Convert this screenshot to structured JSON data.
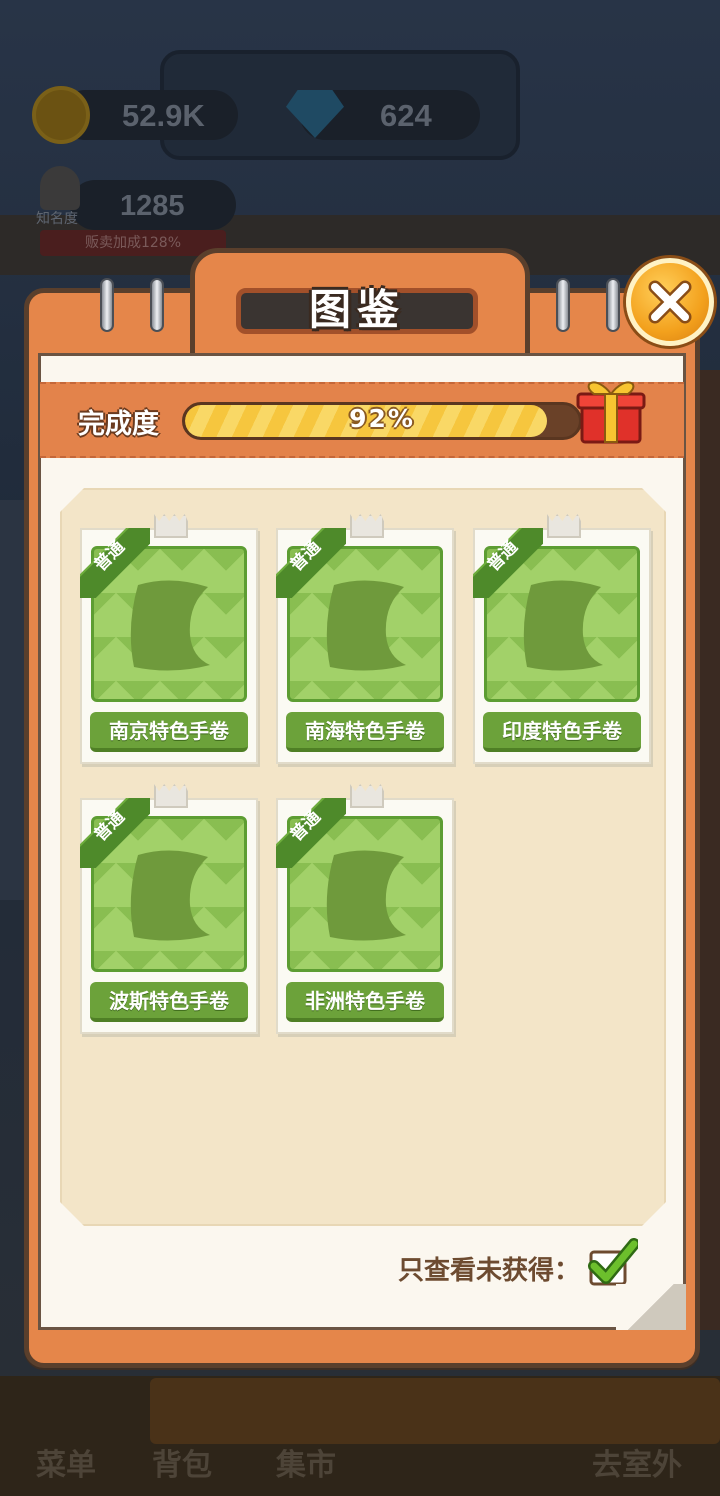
{
  "hud": {
    "coins": "52.9K",
    "gems": "624",
    "fame_value": "1285",
    "fame_label": "知名度",
    "sales_bonus": "贩卖加成128%"
  },
  "bottom_nav": {
    "menu": "菜单",
    "backpack": "背包",
    "market": "集市",
    "go_outside": "去室外"
  },
  "dialog": {
    "title": "图鉴",
    "close_icon": "close-x-icon",
    "progress": {
      "label": "完成度",
      "value_text": "92%",
      "value": 0.92
    },
    "gift_icon": "gift-box-icon",
    "items": [
      {
        "rarity": "普通",
        "name": "南京特色手卷"
      },
      {
        "rarity": "普通",
        "name": "南海特色手卷"
      },
      {
        "rarity": "普通",
        "name": "印度特色手卷"
      },
      {
        "rarity": "普通",
        "name": "波斯特色手卷"
      },
      {
        "rarity": "普通",
        "name": "非洲特色手卷"
      }
    ],
    "filter": {
      "label": "只查看未获得：",
      "checked": true
    }
  },
  "colors": {
    "frame_orange": "#e5864a",
    "card_green": "#a2d169",
    "label_green": "#6ca23a",
    "progress_yellow": "#f6c63e"
  }
}
